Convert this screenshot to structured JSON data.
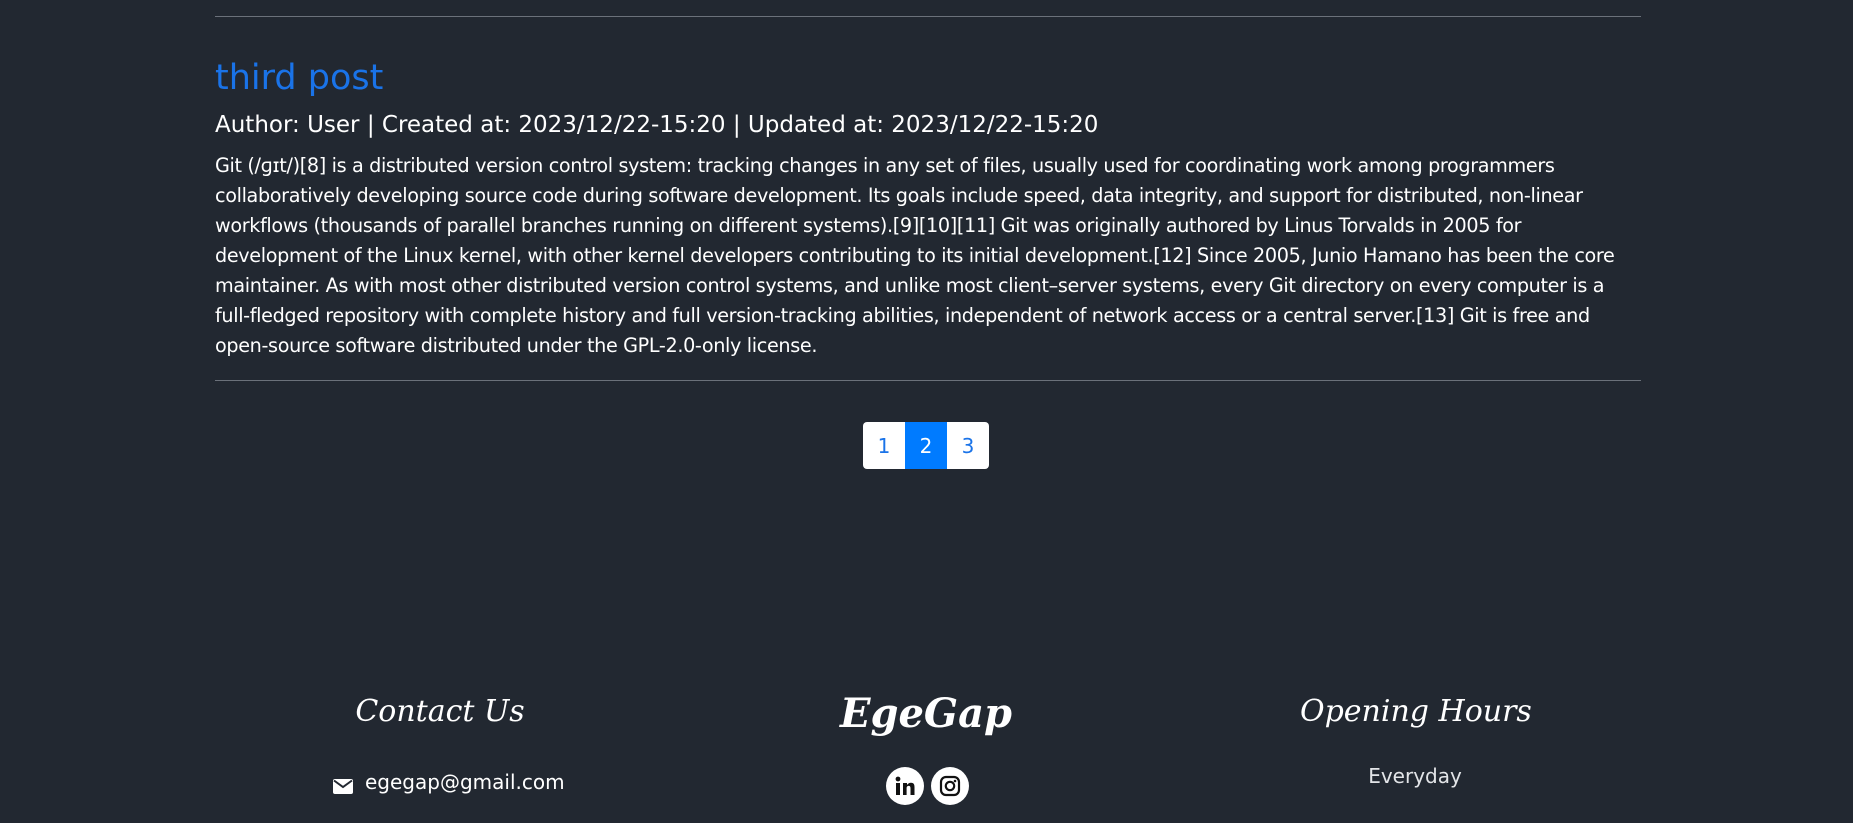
{
  "post": {
    "title": "third post",
    "meta": "Author: User | Created at: 2023/12/22-15:20 | Updated at: 2023/12/22-15:20",
    "body": "Git (/ɡɪt/)[8] is a distributed version control system: tracking changes in any set of files, usually used for coordinating work among programmers collaboratively developing source code during software development. Its goals include speed, data integrity, and support for distributed, non-linear workflows (thousands of parallel branches running on different systems).[9][10][11] Git was originally authored by Linus Torvalds in 2005 for development of the Linux kernel, with other kernel developers contributing to its initial development.[12] Since 2005, Junio Hamano has been the core maintainer. As with most other distributed version control systems, and unlike most client–server systems, every Git directory on every computer is a full-fledged repository with complete history and full version-tracking abilities, independent of network access or a central server.[13] Git is free and open-source software distributed under the GPL-2.0-only license."
  },
  "pagination": {
    "pages": [
      "1",
      "2",
      "3"
    ],
    "active": "2"
  },
  "footer": {
    "contact": {
      "heading": "Contact Us",
      "email": "egegap@gmail.com",
      "icon": "envelope-icon"
    },
    "brand": {
      "name": "EgeGap",
      "socials": [
        "linkedin-icon",
        "instagram-icon"
      ]
    },
    "hours": {
      "heading": "Opening Hours",
      "text": "Everyday"
    }
  },
  "colors": {
    "background": "#222831",
    "link": "#1a73e8",
    "active_page": "#007bff",
    "divider": "#6b717a"
  }
}
